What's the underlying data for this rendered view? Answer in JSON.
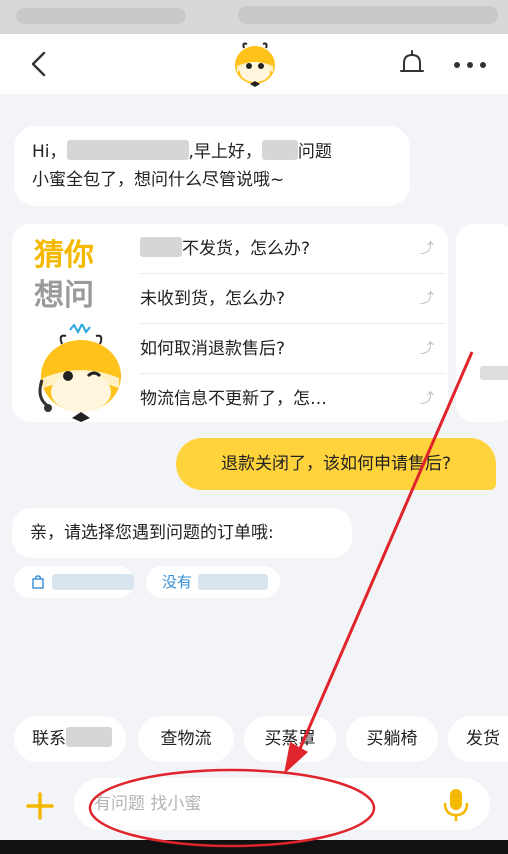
{
  "greeting": {
    "prefix": "Hi，",
    "mid": ",早上好，",
    "suffix": "问题",
    "line2": "小蜜全包了，想问什么尽管说哦~"
  },
  "guess_card": {
    "title_line1": "猜你",
    "title_line2": "想问",
    "questions": [
      {
        "text": "不发货，怎么办?"
      },
      {
        "text": "未收到货，怎么办?"
      },
      {
        "text": "如何取消退款售后?"
      },
      {
        "text": "物流信息不更新了，怎…"
      }
    ]
  },
  "user_message": "退款关闭了，该如何申请售后?",
  "bot_prompt": "亲，请选择您遇到问题的订单哦:",
  "order_chips": {
    "chip2_label": "没有"
  },
  "quick_replies": [
    {
      "label": "联系"
    },
    {
      "label": "查物流"
    },
    {
      "label": "买蒸罩"
    },
    {
      "label": "买躺椅"
    },
    {
      "label": "发货"
    }
  ],
  "input": {
    "placeholder": "有问题 找小蜜"
  },
  "colors": {
    "accent_yellow": "#ffd33c",
    "link_blue": "#3a8fd6",
    "annotation_red": "#e0242b"
  },
  "icons": [
    "back-arrow-icon",
    "mascot-icon",
    "bell-icon",
    "more-icon",
    "shopping-bag-icon",
    "plus-icon",
    "microphone-icon"
  ]
}
